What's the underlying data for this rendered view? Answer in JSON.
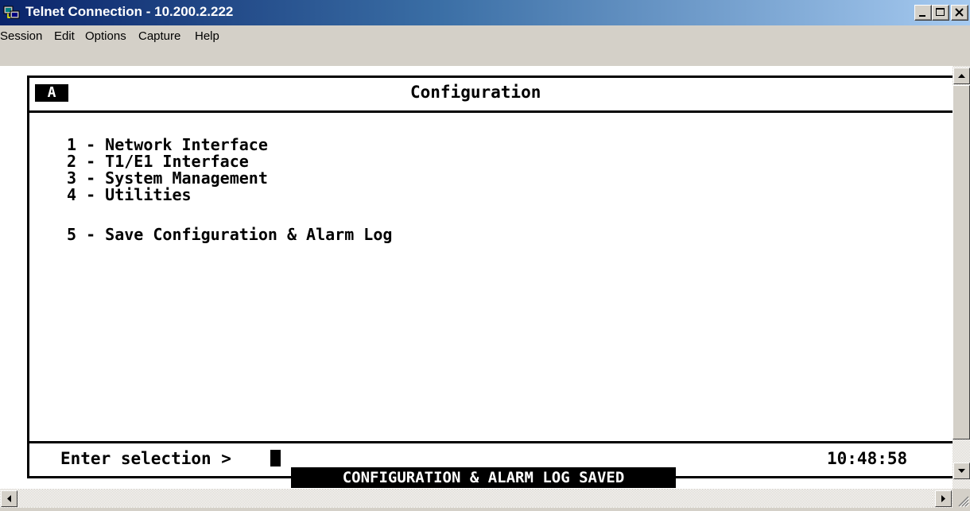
{
  "window": {
    "title": "Telnet Connection - 10.200.2.222",
    "icon": "telnet-icon",
    "controls": [
      "minimize-icon",
      "maximize-icon",
      "close-icon"
    ]
  },
  "menu": {
    "items": [
      "Session",
      "Edit",
      "Options",
      "Capture",
      "Help"
    ]
  },
  "terminal": {
    "session_badge": "A",
    "header_title": "Configuration",
    "options": [
      {
        "text": "1 - Network Interface"
      },
      {
        "text": "2 - T1/E1 Interface"
      },
      {
        "text": "3 - System Management"
      },
      {
        "text": "4 - Utilities"
      },
      {
        "text": "5 - Save Configuration & Alarm Log"
      }
    ],
    "prompt": "Enter selection >",
    "clock": "10:48:58",
    "status_message": "CONFIGURATION & ALARM LOG SAVED"
  },
  "colors": {
    "titlebar_start": "#0a246a",
    "titlebar_end": "#a6caf0",
    "terminal_bg": "#ffffff",
    "terminal_fg": "#000000",
    "chrome": "#d4d0c8"
  }
}
